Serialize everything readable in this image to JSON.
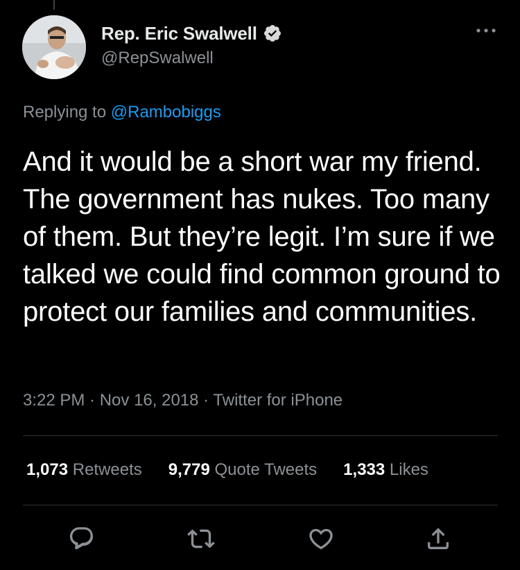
{
  "tweet": {
    "display_name": "Rep. Eric Swalwell",
    "handle": "@RepSwalwell",
    "replying_prefix": "Replying to ",
    "replying_to": "@Rambobiggs",
    "text": "And it would be a short war my friend. The government has nukes. Too many of them. But they’re legit. I’m sure if we talked we could find common ground to protect our families and communities.",
    "time": "3:22 PM",
    "date": "Nov 16, 2018",
    "source": "Twitter for iPhone",
    "separator": " · "
  },
  "stats": {
    "retweets_count": "1,073",
    "retweets_label": "Retweets",
    "quotes_count": "9,779",
    "quotes_label": "Quote Tweets",
    "likes_count": "1,333",
    "likes_label": "Likes"
  },
  "icons": {
    "verified": "verified-badge-icon",
    "more": "more-options-icon",
    "reply": "reply-icon",
    "retweet": "retweet-icon",
    "like": "heart-icon",
    "share": "share-icon"
  },
  "colors": {
    "background": "#000000",
    "text_primary": "#ffffff",
    "text_secondary": "#8b9196",
    "link": "#1d9bf0",
    "divider": "#2f3336"
  }
}
